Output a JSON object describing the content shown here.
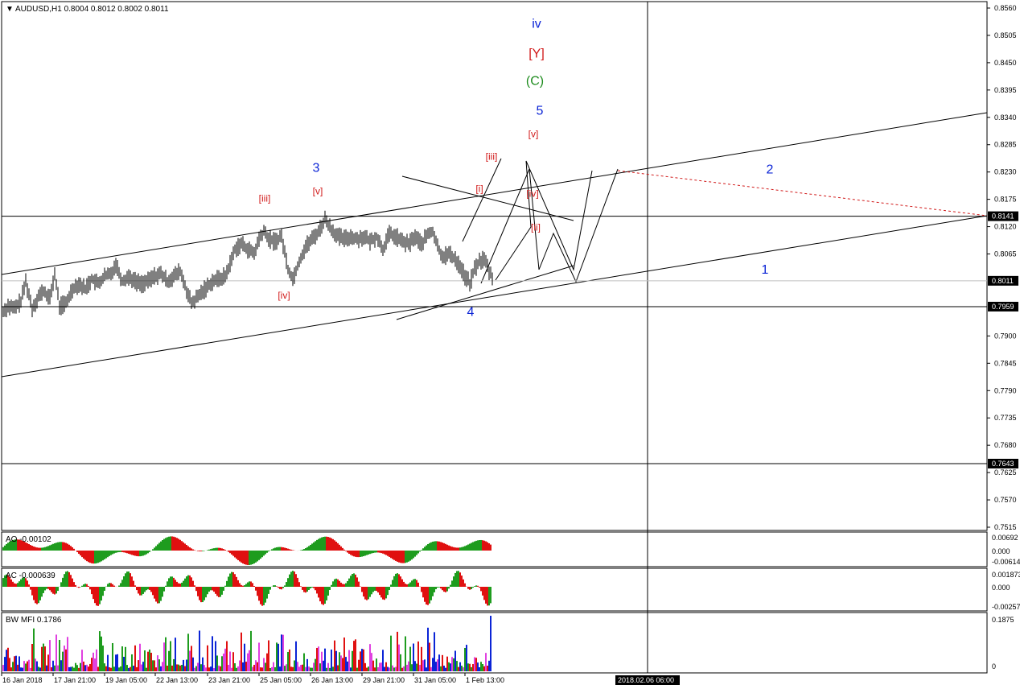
{
  "chart_data": [
    {
      "type": "candlestick",
      "header": "AUDUSD,H1 0.8004 0.8012 0.8002 0.8011",
      "symbol": "AUDUSD",
      "timeframe": "H1",
      "ohlc_current": [
        0.8004,
        0.8012,
        0.8002,
        0.8011
      ],
      "ylim": [
        0.7515,
        0.856
      ],
      "price_ticks": [
        "0.8560",
        "0.8505",
        "0.8450",
        "0.8395",
        "0.8340",
        "0.8285",
        "0.8230",
        "0.8175",
        "0.8120",
        "0.8065",
        "0.8011",
        "0.7959",
        "0.7900",
        "0.7845",
        "0.7790",
        "0.7735",
        "0.7680",
        "0.7643",
        "0.7625",
        "0.7570",
        "0.7515"
      ],
      "price_tick_values": [
        0.856,
        0.8505,
        0.845,
        0.8395,
        0.834,
        0.8285,
        0.823,
        0.8175,
        0.812,
        0.8065,
        0.8011,
        0.7959,
        0.79,
        0.7845,
        0.779,
        0.7735,
        0.768,
        0.7643,
        0.7625,
        0.757,
        0.7515
      ],
      "price_labels_boxed": [
        {
          "text": "0.8141",
          "value": 0.8141
        },
        {
          "text": "0.8011",
          "value": 0.8011
        },
        {
          "text": "0.7959",
          "value": 0.7959
        },
        {
          "text": "0.7643",
          "value": 0.7643
        }
      ],
      "horizontal_lines": [
        0.8141,
        0.7959,
        0.7643
      ],
      "current_price_line": 0.8011,
      "time_labels": [
        "16 Jan 2018",
        "17 Jan 21:00",
        "19 Jan 05:00",
        "22 Jan 13:00",
        "23 Jan 21:00",
        "25 Jan 05:00",
        "26 Jan 13:00",
        "29 Jan 21:00",
        "31 Jan 05:00",
        "1 Feb 13:00"
      ],
      "cursor_time_label": "2018.02.06 06:00",
      "series_path_close": [
        [
          0,
          0.7945
        ],
        [
          8,
          0.796
        ],
        [
          16,
          0.7955
        ],
        [
          24,
          0.797
        ],
        [
          30,
          0.801
        ],
        [
          38,
          0.7955
        ],
        [
          46,
          0.798
        ],
        [
          52,
          0.799
        ],
        [
          60,
          0.7975
        ],
        [
          66,
          0.8025
        ],
        [
          72,
          0.796
        ],
        [
          80,
          0.7965
        ],
        [
          88,
          0.7995
        ],
        [
          96,
          0.8005
        ],
        [
          104,
          0.7995
        ],
        [
          112,
          0.8015
        ],
        [
          120,
          0.8005
        ],
        [
          128,
          0.802
        ],
        [
          136,
          0.8025
        ],
        [
          142,
          0.8045
        ],
        [
          150,
          0.801
        ],
        [
          158,
          0.802
        ],
        [
          166,
          0.801
        ],
        [
          174,
          0.8005
        ],
        [
          182,
          0.801
        ],
        [
          190,
          0.802
        ],
        [
          198,
          0.8025
        ],
        [
          206,
          0.801
        ],
        [
          214,
          0.802
        ],
        [
          222,
          0.803
        ],
        [
          228,
          0.8
        ],
        [
          236,
          0.7965
        ],
        [
          242,
          0.7975
        ],
        [
          250,
          0.799
        ],
        [
          256,
          0.8
        ],
        [
          262,
          0.801
        ],
        [
          270,
          0.8015
        ],
        [
          278,
          0.802
        ],
        [
          284,
          0.8045
        ],
        [
          290,
          0.8075
        ],
        [
          298,
          0.8085
        ],
        [
          306,
          0.8075
        ],
        [
          314,
          0.8065
        ],
        [
          320,
          0.8095
        ],
        [
          326,
          0.811
        ],
        [
          332,
          0.8095
        ],
        [
          340,
          0.809
        ],
        [
          348,
          0.81
        ],
        [
          356,
          0.8035
        ],
        [
          362,
          0.8015
        ],
        [
          370,
          0.805
        ],
        [
          378,
          0.808
        ],
        [
          386,
          0.8095
        ],
        [
          394,
          0.811
        ],
        [
          402,
          0.8135
        ],
        [
          410,
          0.8115
        ],
        [
          418,
          0.81
        ],
        [
          426,
          0.8095
        ],
        [
          434,
          0.81
        ],
        [
          442,
          0.8095
        ],
        [
          450,
          0.81
        ],
        [
          458,
          0.809
        ],
        [
          466,
          0.81
        ],
        [
          474,
          0.8075
        ],
        [
          482,
          0.8105
        ],
        [
          490,
          0.81
        ],
        [
          498,
          0.809
        ],
        [
          506,
          0.8085
        ],
        [
          514,
          0.81
        ],
        [
          522,
          0.8085
        ],
        [
          530,
          0.8105
        ],
        [
          536,
          0.811
        ],
        [
          542,
          0.808
        ],
        [
          548,
          0.806
        ],
        [
          556,
          0.8065
        ],
        [
          564,
          0.8055
        ],
        [
          570,
          0.804
        ],
        [
          576,
          0.802
        ],
        [
          582,
          0.8005
        ],
        [
          588,
          0.8035
        ],
        [
          594,
          0.805
        ],
        [
          600,
          0.8055
        ],
        [
          606,
          0.803
        ],
        [
          612,
          0.8011
        ]
      ],
      "wave_labels": [
        {
          "text": "iv",
          "color": "#0b24d6",
          "time_px": 667,
          "price": 0.852
        },
        {
          "text": "[Y]",
          "color": "#d11919",
          "time_px": 667,
          "price": 0.846
        },
        {
          "text": "(C)",
          "color": "#1e8c1e",
          "time_px": 665,
          "price": 0.8405
        },
        {
          "text": "5",
          "color": "#0b24d6",
          "time_px": 671,
          "price": 0.8345
        },
        {
          "text": "[v]",
          "color": "#d11919",
          "time_px": 663,
          "price": 0.83
        },
        {
          "text": "[iii]",
          "color": "#d11919",
          "time_px": 611,
          "price": 0.8255
        },
        {
          "text": "[i]",
          "color": "#d11919",
          "time_px": 596,
          "price": 0.819
        },
        {
          "text": "[iv]",
          "color": "#d11919",
          "time_px": 662,
          "price": 0.818
        },
        {
          "text": "[ii]",
          "color": "#d11919",
          "time_px": 666,
          "price": 0.8112
        },
        {
          "text": "3",
          "color": "#0b24d6",
          "time_px": 393,
          "price": 0.823
        },
        {
          "text": "[iii]",
          "color": "#d11919",
          "time_px": 329,
          "price": 0.817
        },
        {
          "text": "[v]",
          "color": "#d11919",
          "time_px": 395,
          "price": 0.8185
        },
        {
          "text": "[iv]",
          "color": "#d11919",
          "time_px": 353,
          "price": 0.7975
        },
        {
          "text": "4",
          "color": "#0b24d6",
          "time_px": 585,
          "price": 0.794
        },
        {
          "text": "2",
          "color": "#0b24d6",
          "time_px": 957,
          "price": 0.8227
        },
        {
          "text": "1",
          "color": "#0b24d6",
          "time_px": 951,
          "price": 0.8025
        }
      ]
    },
    {
      "type": "histogram",
      "label": "AO -0.00102",
      "ticks": [
        "0.00692",
        "0.000",
        "-0.00614"
      ],
      "ylim": [
        -0.00614,
        0.00692
      ]
    },
    {
      "type": "histogram",
      "label": "AC -0.000639",
      "ticks": [
        "0.001873",
        "0.000",
        "-0.00257"
      ],
      "ylim": [
        -0.00257,
        0.001873
      ]
    },
    {
      "type": "histogram",
      "label": "BW MFI 0.1786",
      "ticks": [
        "0.1875",
        "0"
      ],
      "ylim": [
        0,
        0.1875
      ]
    }
  ]
}
